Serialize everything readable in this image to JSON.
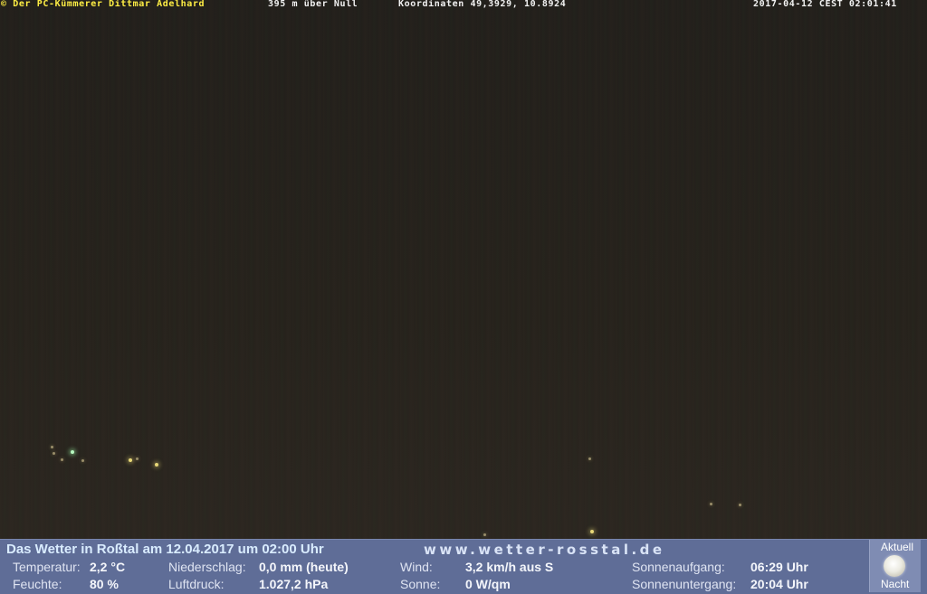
{
  "overlay": {
    "copyright": "© Der PC-Kümmerer Dittmar Adelhard",
    "altitude": "395 m über Null",
    "coordinates": "Koordinaten 49,3929, 10.8924",
    "timestamp": "2017-04-12 CEST 02:01:41"
  },
  "panel": {
    "title": "Das Wetter in Roßtal am 12.04.2017 um 02:00 Uhr",
    "url": "www.wetter-rosstal.de",
    "temperature": {
      "label": "Temperatur:",
      "value": "2,2 °C"
    },
    "humidity": {
      "label": "Feuchte:",
      "value": "80 %"
    },
    "precipitation": {
      "label": "Niederschlag:",
      "value": "0,0 mm (heute)"
    },
    "pressure": {
      "label": "Luftdruck:",
      "value": "1.027,2 hPa"
    },
    "wind": {
      "label": "Wind:",
      "value": "3,2 km/h aus S"
    },
    "sun": {
      "label": "Sonne:",
      "value": "0 W/qm"
    },
    "sunrise": {
      "label": "Sonnenaufgang:",
      "value": "06:29 Uhr"
    },
    "sunset": {
      "label": "Sonnenuntergang:",
      "value": "20:04 Uhr"
    },
    "moon": {
      "top_label": "Aktuell",
      "bottom_label": "Nacht",
      "icon": "full-moon-icon"
    }
  },
  "colors": {
    "overlay_yellow": "#ffee44",
    "overlay_white": "#f2f2f2",
    "panel_bg": "#5f6d97"
  }
}
